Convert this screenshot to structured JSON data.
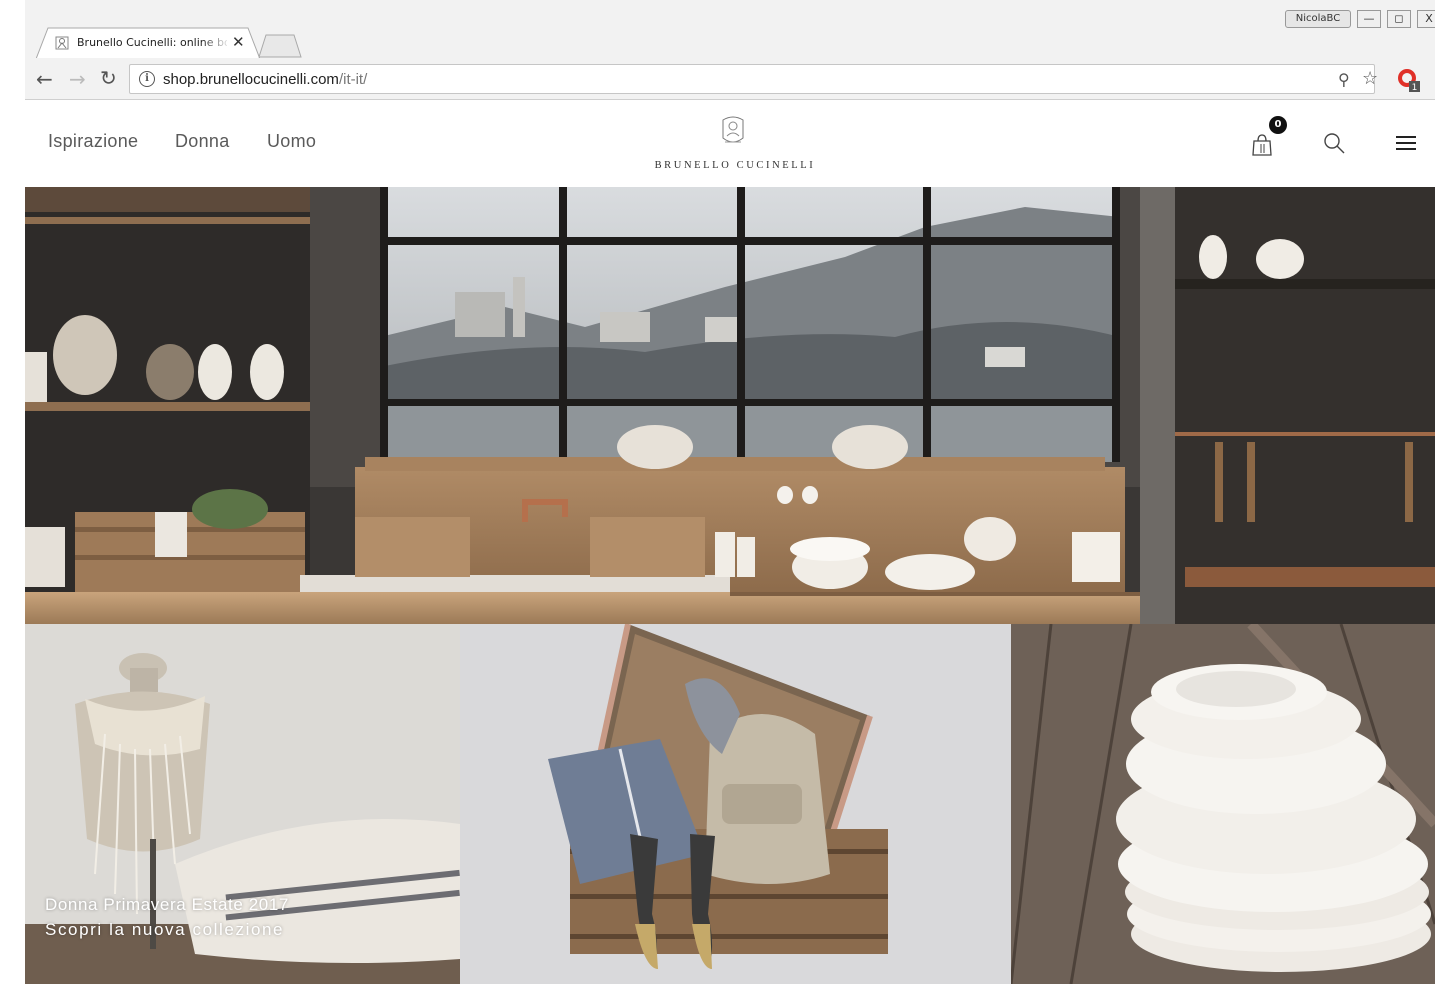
{
  "browser": {
    "tab_title": "Brunello Cucinelli: online bo",
    "user_badge": "NicolaBC",
    "window_controls": {
      "minimize": "—",
      "maximize": "◻",
      "close": "X"
    },
    "url_host": "shop.brunellocucinelli.com",
    "url_path": "/it-it/",
    "icons": [
      "back-icon",
      "forward-icon",
      "reload-icon",
      "info-icon",
      "zoom-icon",
      "star-icon",
      "extension-icon"
    ],
    "extension_badge": "1"
  },
  "site": {
    "nav": [
      "Ispirazione",
      "Donna",
      "Uomo"
    ],
    "logo_text": "BRUNELLO CUCINELLI",
    "cart_count": "0",
    "icons": [
      "bag-icon",
      "search-icon",
      "menu-icon"
    ]
  },
  "hero": {
    "scene": "kitchen-window-landscape"
  },
  "tiles": {
    "first": {
      "caption_line1": "Donna Primavera Estate 2017",
      "caption_line2": "Scopri la nuova collezione"
    }
  }
}
